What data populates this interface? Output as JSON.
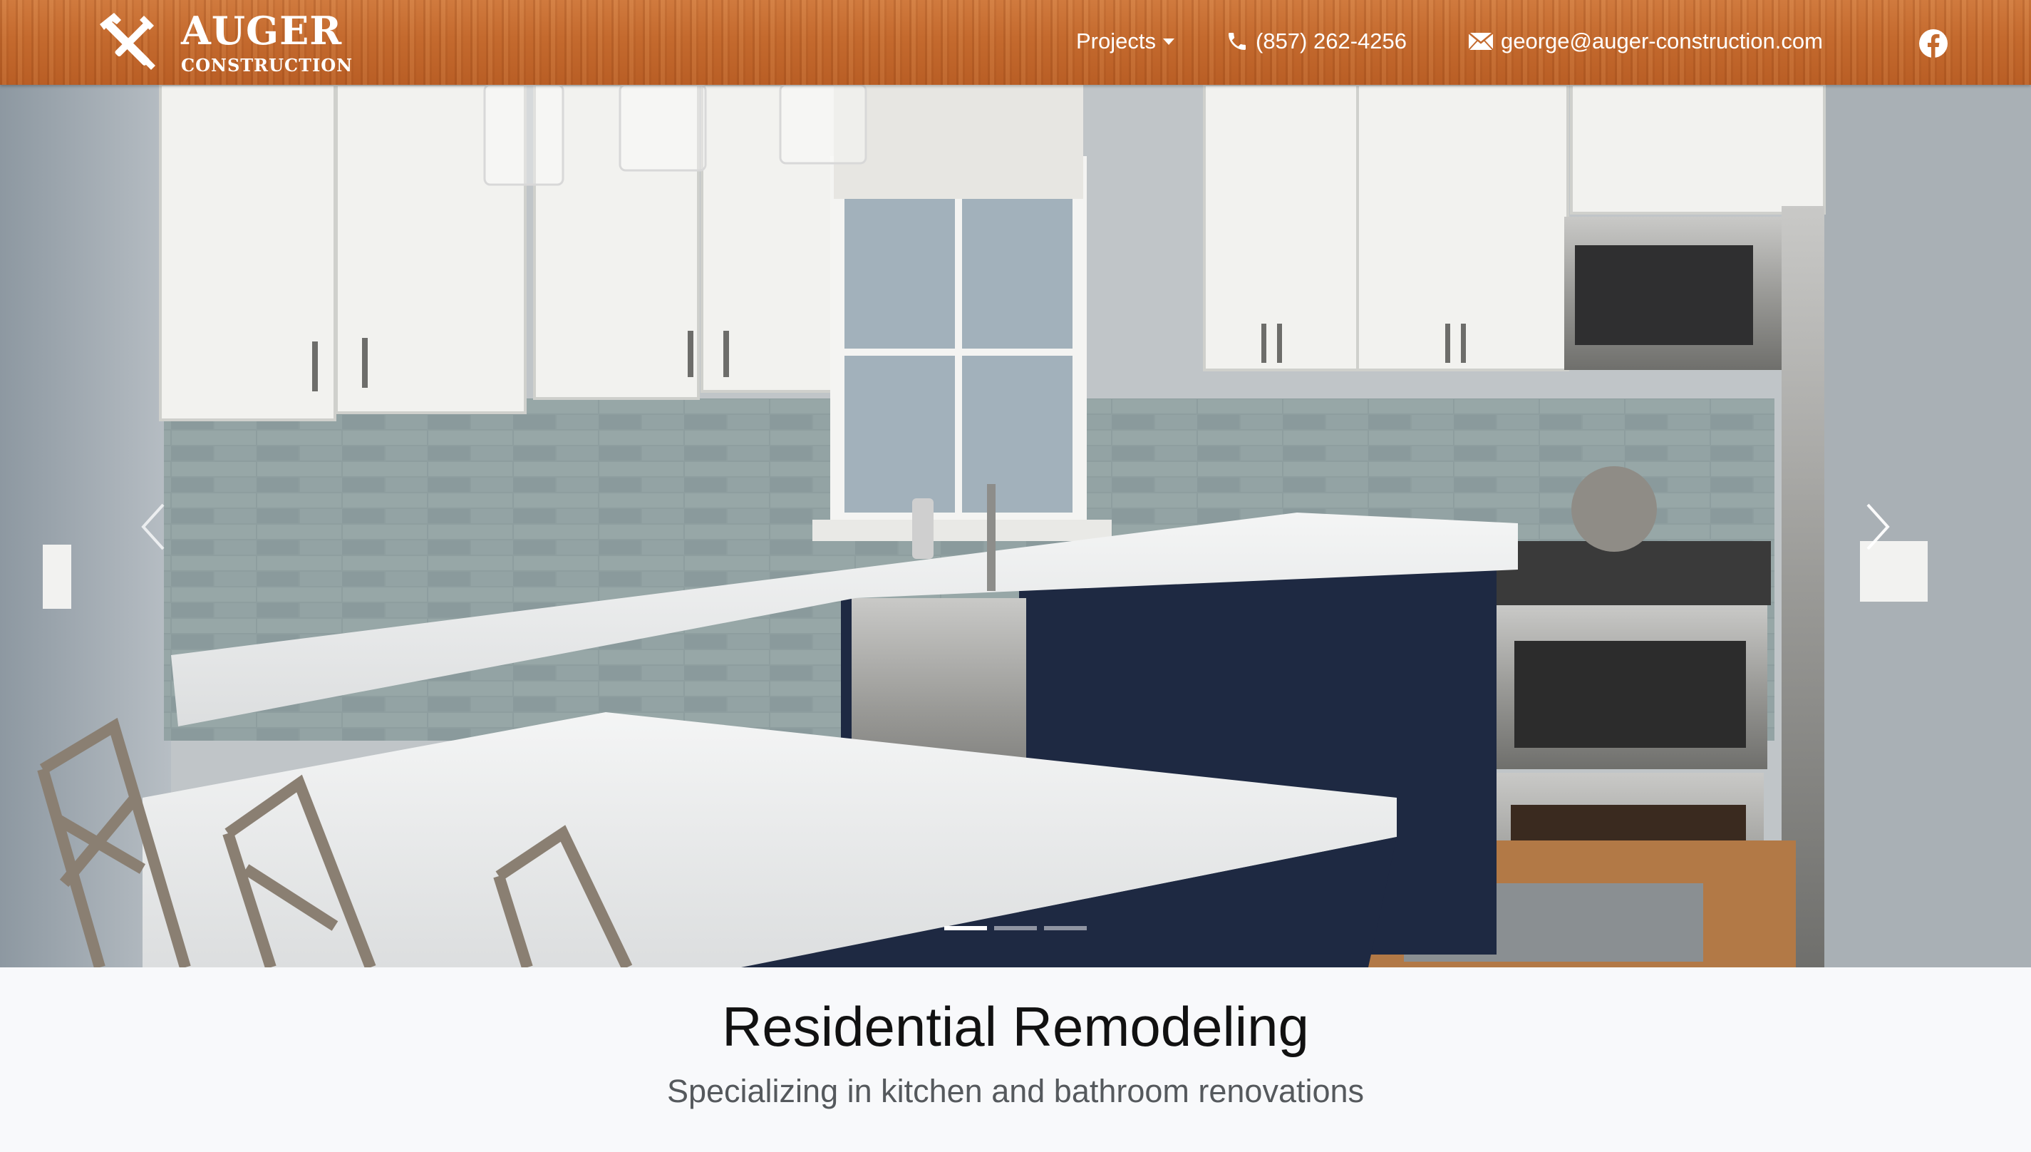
{
  "brand": {
    "name": "AUGER",
    "subtitle": "CONSTRUCTION",
    "logo_icon": "hammer-and-brush-icon"
  },
  "nav": {
    "projects_label": "Projects",
    "phone": "(857) 262-4256",
    "email": "george@auger-construction.com",
    "phone_icon": "phone-icon",
    "email_icon": "envelope-icon",
    "social_icon": "facebook-icon"
  },
  "carousel": {
    "slide_count": 3,
    "active_index": 0,
    "prev_icon": "chevron-left-icon",
    "next_icon": "chevron-right-icon"
  },
  "intro": {
    "title": "Residential Remodeling",
    "subtitle": "Specializing in kitchen and bathroom renovations"
  },
  "colors": {
    "navbar_wood": "#c46a2e",
    "page_background": "#f8f9fb",
    "title_text": "#111111",
    "subtitle_text": "#55595d"
  }
}
